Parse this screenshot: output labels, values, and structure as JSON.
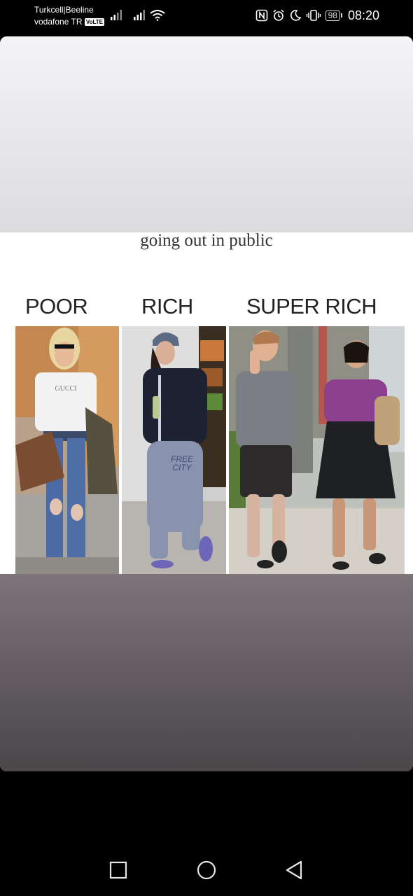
{
  "status_bar": {
    "carrier_1": "Turkcell|Beeline",
    "carrier_2": "vodafone TR",
    "volte_badge": "VoLTE",
    "battery": "98",
    "time": "08:20"
  },
  "meme": {
    "caption": "going out in public",
    "columns": [
      {
        "label": "POOR"
      },
      {
        "label": "RICH"
      },
      {
        "label": "SUPER RICH"
      }
    ],
    "shirt_texts": [
      "GUCCI",
      "FREE CITY"
    ]
  },
  "colors": {
    "background": "#000000",
    "card_top": "#e8e8ea",
    "card_bottom": "#5e585c"
  },
  "nav": {
    "recents_icon": "square-icon",
    "home_icon": "circle-icon",
    "back_icon": "triangle-back-icon"
  }
}
